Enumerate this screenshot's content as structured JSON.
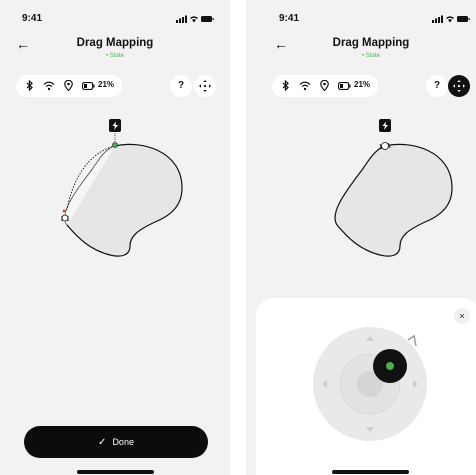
{
  "status": {
    "time": "9:41"
  },
  "header": {
    "title": "Drag Mapping",
    "subtitle": "• State"
  },
  "toolbar": {
    "battery": "21%",
    "help": "?"
  },
  "actions": {
    "done": "Done",
    "close": "×"
  },
  "colors": {
    "accent_green": "#4caf50",
    "dark": "#111111"
  },
  "icons": [
    "back-arrow-icon",
    "bluetooth-icon",
    "wifi-icon",
    "location-icon",
    "battery-icon",
    "help-icon",
    "move-icon",
    "charging-dock-icon",
    "close-icon",
    "check-icon"
  ]
}
